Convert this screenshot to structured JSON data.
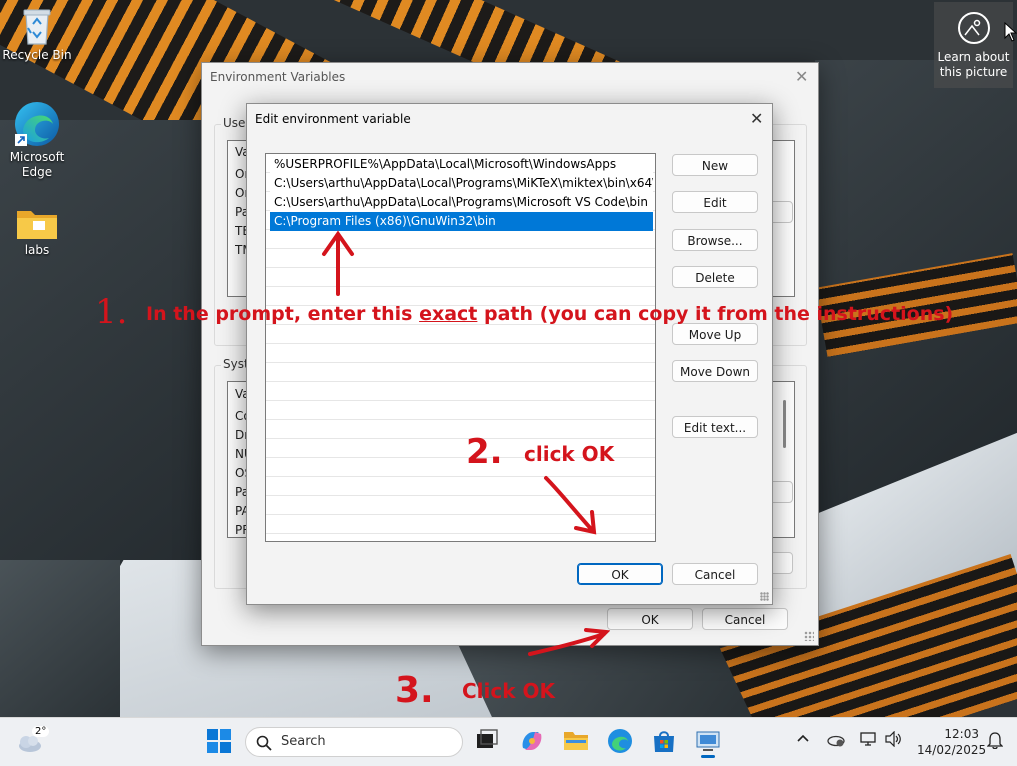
{
  "desktop": {
    "icons": [
      {
        "label": "Recycle Bin"
      },
      {
        "label": "Microsoft Edge"
      },
      {
        "label": "labs"
      }
    ],
    "learn_label": "Learn about this picture"
  },
  "env_window": {
    "title": "Environment Variables",
    "user_group_label": "User",
    "user_list_header": "Va",
    "user_rows": [
      "On",
      "On",
      "Pa",
      "TE",
      "TM"
    ],
    "system_group_label": "Syste",
    "system_list_header": "Va",
    "system_rows": [
      "Co",
      "Dri",
      "NU",
      "OS",
      "Pa",
      "PA",
      "PR"
    ],
    "ok_label": "OK",
    "cancel_label": "Cancel"
  },
  "edit_dialog": {
    "title": "Edit environment variable",
    "entries": [
      "%USERPROFILE%\\AppData\\Local\\Microsoft\\WindowsApps",
      "C:\\Users\\arthu\\AppData\\Local\\Programs\\MiKTeX\\miktex\\bin\\x64\\",
      "C:\\Users\\arthu\\AppData\\Local\\Programs\\Microsoft VS Code\\bin",
      "C:\\Program Files (x86)\\GnuWin32\\bin"
    ],
    "selected_index": 3,
    "buttons": {
      "new": "New",
      "edit": "Edit",
      "browse": "Browse...",
      "delete": "Delete",
      "move_up": "Move Up",
      "move_down": "Move Down",
      "edit_text": "Edit text..."
    },
    "ok_label": "OK",
    "cancel_label": "Cancel"
  },
  "annotations": {
    "step1_number": "1.",
    "step1_text_before": "In the prompt, enter this ",
    "step1_text_emph": "exact",
    "step1_text_after": " path (you can copy it from the instructions)",
    "step2_number": "2.",
    "step2_text": "click OK",
    "step3_number": "3.",
    "step3_text": "Click OK",
    "color": "#d4141c"
  },
  "taskbar": {
    "weather_temp": "2°",
    "search_placeholder": "Search",
    "time": "12:03",
    "date": "14/02/2025"
  }
}
